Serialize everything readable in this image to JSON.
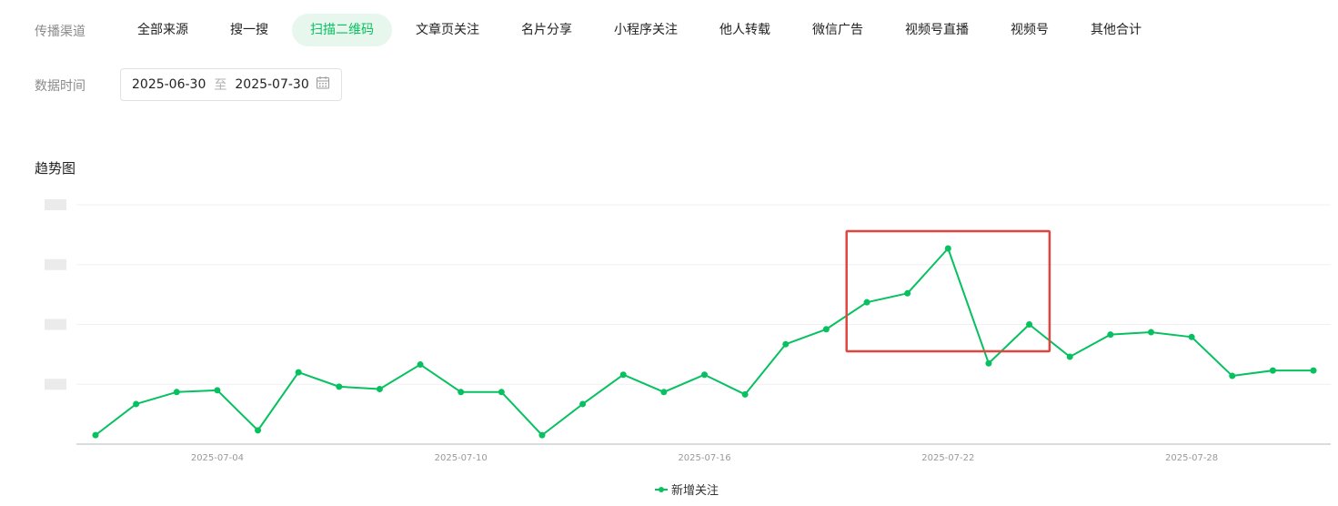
{
  "filters": {
    "channel_label": "传播渠道",
    "channels": [
      "全部来源",
      "搜一搜",
      "扫描二维码",
      "文章页关注",
      "名片分享",
      "小程序关注",
      "他人转载",
      "微信广告",
      "视频号直播",
      "视频号",
      "其他合计"
    ],
    "active_channel": "扫描二维码",
    "time_label": "数据时间",
    "start_date": "2025-06-30",
    "separator": "至",
    "end_date": "2025-07-30"
  },
  "section_title": "趋势图",
  "colors": {
    "accent": "#07c160",
    "accent_bg": "#e7f7ee",
    "highlight": "#e0463f"
  },
  "chart_data": {
    "type": "line",
    "x": [
      "2025-07-01",
      "2025-07-02",
      "2025-07-03",
      "2025-07-04",
      "2025-07-05",
      "2025-07-06",
      "2025-07-07",
      "2025-07-08",
      "2025-07-09",
      "2025-07-10",
      "2025-07-11",
      "2025-07-12",
      "2025-07-13",
      "2025-07-14",
      "2025-07-15",
      "2025-07-16",
      "2025-07-17",
      "2025-07-18",
      "2025-07-19",
      "2025-07-20",
      "2025-07-21",
      "2025-07-22",
      "2025-07-23",
      "2025-07-24",
      "2025-07-25",
      "2025-07-26",
      "2025-07-27",
      "2025-07-28",
      "2025-07-29",
      "2025-07-30",
      "2025-07-31"
    ],
    "x_tick_labels": [
      "2025-07-04",
      "2025-07-10",
      "2025-07-16",
      "2025-07-22",
      "2025-07-28"
    ],
    "series": [
      {
        "name": "新增关注",
        "values": [
          0.15,
          0.67,
          0.87,
          0.9,
          0.23,
          1.2,
          0.96,
          0.92,
          1.33,
          0.87,
          0.87,
          0.15,
          0.67,
          1.16,
          0.87,
          1.16,
          0.83,
          1.67,
          1.92,
          2.37,
          2.52,
          3.27,
          1.35,
          2.0,
          1.46,
          1.83,
          1.87,
          1.79,
          1.14,
          1.23,
          1.23
        ]
      }
    ],
    "y_tick_labels_hidden": true,
    "ylim": [
      0,
      4
    ],
    "grid": true,
    "legend": "bottom-center",
    "highlight_range": [
      "2025-07-19",
      "2025-07-25"
    ]
  }
}
